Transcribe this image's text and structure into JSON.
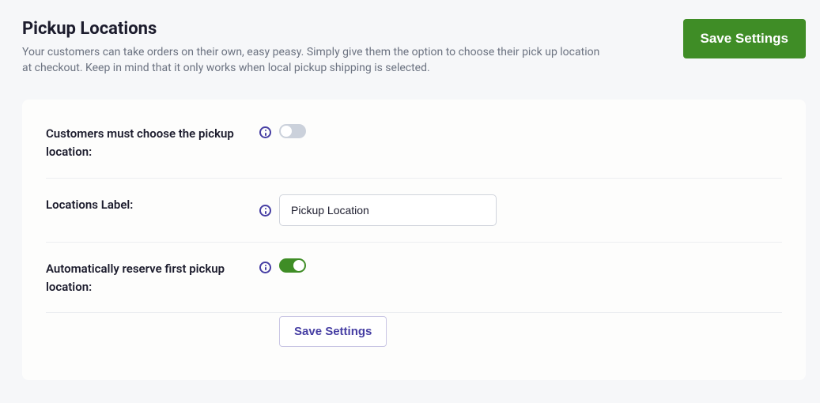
{
  "header": {
    "title": "Pickup Locations",
    "description": "Your customers can take orders on their own, easy peasy. Simply give them the option to choose their pick up location at checkout. Keep in mind that it only works when local pickup shipping is selected.",
    "save_button": "Save Settings"
  },
  "form": {
    "rows": [
      {
        "label": "Customers must choose the pickup location:",
        "toggle_state": "off"
      },
      {
        "label": "Locations Label:",
        "input_value": "Pickup Location"
      },
      {
        "label": "Automatically reserve first pickup location:",
        "toggle_state": "on"
      }
    ],
    "save_button": "Save Settings"
  }
}
